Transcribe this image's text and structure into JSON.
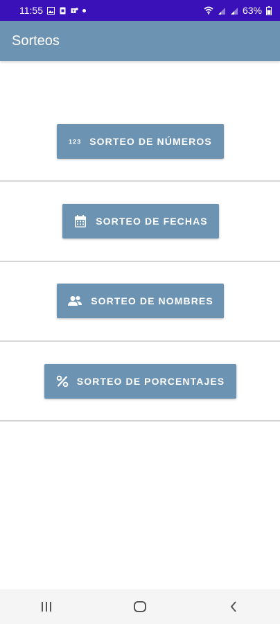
{
  "status_bar": {
    "time": "11:55",
    "battery": "63%"
  },
  "app_bar": {
    "title": "Sorteos"
  },
  "buttons": [
    {
      "label": "SORTEO DE NÚMEROS",
      "icon": "numbers-123-icon",
      "icon_text": "123"
    },
    {
      "label": "SORTEO DE FECHAS",
      "icon": "calendar-icon"
    },
    {
      "label": "SORTEO DE NOMBRES",
      "icon": "people-icon"
    },
    {
      "label": "SORTEO DE PORCENTAJES",
      "icon": "percent-icon"
    }
  ],
  "colors": {
    "status_bar": "#3a10b8",
    "primary": "#6d93b3",
    "divider": "#d7d7d7",
    "nav_bar": "#f5f5f5"
  },
  "nav_bar": {
    "icons": [
      "recents-icon",
      "home-icon",
      "back-icon"
    ]
  }
}
